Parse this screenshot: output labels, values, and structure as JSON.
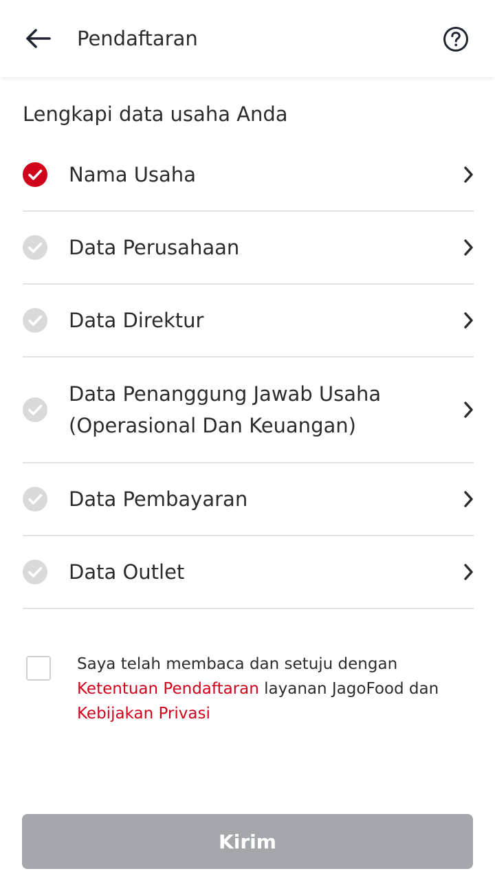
{
  "colors": {
    "accent": "#d0021b",
    "check_done": "#d0021b",
    "check_pending": "#d9d9d9",
    "divider": "#e2e2e2",
    "button_disabled": "#a3a6aa"
  },
  "appbar": {
    "title": "Pendaftaran",
    "back_icon": "arrow-left-icon",
    "help_icon": "question-circle-icon"
  },
  "section_title": "Lengkapi data usaha Anda",
  "steps": [
    {
      "label": "Nama Usaha",
      "done": true
    },
    {
      "label": "Data Perusahaan",
      "done": false
    },
    {
      "label": "Data Direktur",
      "done": false
    },
    {
      "label": "Data Penanggung Jawab Usaha (Operasional Dan Keuangan)",
      "done": false
    },
    {
      "label": "Data Pembayaran",
      "done": false
    },
    {
      "label": "Data Outlet",
      "done": false
    }
  ],
  "agreement": {
    "checked": false,
    "text_before": "Saya telah membaca dan setuju dengan ",
    "link_terms": "Ketentuan Pendaftaran",
    "text_middle": " layanan JagoFood dan ",
    "link_privacy": "Kebijakan Privasi"
  },
  "submit": {
    "label": "Kirim",
    "enabled": false
  }
}
